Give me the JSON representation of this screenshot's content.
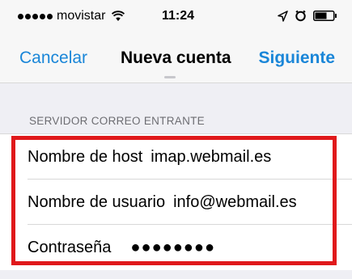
{
  "status_bar": {
    "carrier": "movistar",
    "time": "11:24",
    "signal_icon": "signal-dots-icon",
    "wifi_icon": "wifi-icon",
    "location_icon": "location-arrow-icon",
    "alarm_icon": "alarm-clock-icon",
    "battery_icon": "battery-icon"
  },
  "nav": {
    "cancel_label": "Cancelar",
    "title": "Nueva cuenta",
    "next_label": "Siguiente"
  },
  "incoming_server": {
    "section_title": "SERVIDOR CORREO ENTRANTE",
    "rows": [
      {
        "label": "Nombre de host",
        "value": "imap.webmail.es"
      },
      {
        "label": "Nombre de usuario",
        "value": "info@webmail.es"
      },
      {
        "label": "Contraseña",
        "value": "●●●●●●●●"
      }
    ]
  },
  "colors": {
    "accent": "#1a86d8",
    "highlight": "#e0191b",
    "group_background": "#efeff4"
  }
}
